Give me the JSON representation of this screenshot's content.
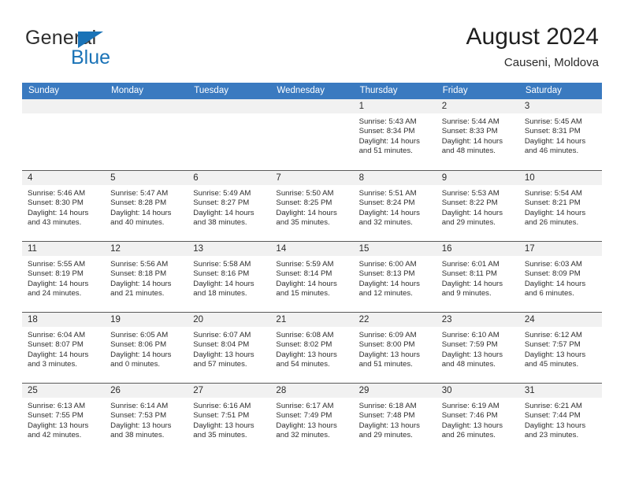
{
  "brand": {
    "name_top": "General",
    "name_bottom": "Blue",
    "accent_color": "#1a73b7",
    "triangle_icon": "triangle-icon"
  },
  "header": {
    "title": "August 2024",
    "subtitle": "Causeni, Moldova",
    "header_bg": "#3a7ac0",
    "header_text": "#ffffff"
  },
  "calendar": {
    "weekday_headers": [
      "Sunday",
      "Monday",
      "Tuesday",
      "Wednesday",
      "Thursday",
      "Friday",
      "Saturday"
    ],
    "labels": {
      "sunrise": "Sunrise:",
      "sunset": "Sunset:",
      "daylight": "Daylight:"
    },
    "weeks": [
      [
        {
          "day": ""
        },
        {
          "day": ""
        },
        {
          "day": ""
        },
        {
          "day": ""
        },
        {
          "day": "1",
          "sunrise": "Sunrise: 5:43 AM",
          "sunset": "Sunset: 8:34 PM",
          "daylight1": "Daylight: 14 hours",
          "daylight2": "and 51 minutes."
        },
        {
          "day": "2",
          "sunrise": "Sunrise: 5:44 AM",
          "sunset": "Sunset: 8:33 PM",
          "daylight1": "Daylight: 14 hours",
          "daylight2": "and 48 minutes."
        },
        {
          "day": "3",
          "sunrise": "Sunrise: 5:45 AM",
          "sunset": "Sunset: 8:31 PM",
          "daylight1": "Daylight: 14 hours",
          "daylight2": "and 46 minutes."
        }
      ],
      [
        {
          "day": "4",
          "sunrise": "Sunrise: 5:46 AM",
          "sunset": "Sunset: 8:30 PM",
          "daylight1": "Daylight: 14 hours",
          "daylight2": "and 43 minutes."
        },
        {
          "day": "5",
          "sunrise": "Sunrise: 5:47 AM",
          "sunset": "Sunset: 8:28 PM",
          "daylight1": "Daylight: 14 hours",
          "daylight2": "and 40 minutes."
        },
        {
          "day": "6",
          "sunrise": "Sunrise: 5:49 AM",
          "sunset": "Sunset: 8:27 PM",
          "daylight1": "Daylight: 14 hours",
          "daylight2": "and 38 minutes."
        },
        {
          "day": "7",
          "sunrise": "Sunrise: 5:50 AM",
          "sunset": "Sunset: 8:25 PM",
          "daylight1": "Daylight: 14 hours",
          "daylight2": "and 35 minutes."
        },
        {
          "day": "8",
          "sunrise": "Sunrise: 5:51 AM",
          "sunset": "Sunset: 8:24 PM",
          "daylight1": "Daylight: 14 hours",
          "daylight2": "and 32 minutes."
        },
        {
          "day": "9",
          "sunrise": "Sunrise: 5:53 AM",
          "sunset": "Sunset: 8:22 PM",
          "daylight1": "Daylight: 14 hours",
          "daylight2": "and 29 minutes."
        },
        {
          "day": "10",
          "sunrise": "Sunrise: 5:54 AM",
          "sunset": "Sunset: 8:21 PM",
          "daylight1": "Daylight: 14 hours",
          "daylight2": "and 26 minutes."
        }
      ],
      [
        {
          "day": "11",
          "sunrise": "Sunrise: 5:55 AM",
          "sunset": "Sunset: 8:19 PM",
          "daylight1": "Daylight: 14 hours",
          "daylight2": "and 24 minutes."
        },
        {
          "day": "12",
          "sunrise": "Sunrise: 5:56 AM",
          "sunset": "Sunset: 8:18 PM",
          "daylight1": "Daylight: 14 hours",
          "daylight2": "and 21 minutes."
        },
        {
          "day": "13",
          "sunrise": "Sunrise: 5:58 AM",
          "sunset": "Sunset: 8:16 PM",
          "daylight1": "Daylight: 14 hours",
          "daylight2": "and 18 minutes."
        },
        {
          "day": "14",
          "sunrise": "Sunrise: 5:59 AM",
          "sunset": "Sunset: 8:14 PM",
          "daylight1": "Daylight: 14 hours",
          "daylight2": "and 15 minutes."
        },
        {
          "day": "15",
          "sunrise": "Sunrise: 6:00 AM",
          "sunset": "Sunset: 8:13 PM",
          "daylight1": "Daylight: 14 hours",
          "daylight2": "and 12 minutes."
        },
        {
          "day": "16",
          "sunrise": "Sunrise: 6:01 AM",
          "sunset": "Sunset: 8:11 PM",
          "daylight1": "Daylight: 14 hours",
          "daylight2": "and 9 minutes."
        },
        {
          "day": "17",
          "sunrise": "Sunrise: 6:03 AM",
          "sunset": "Sunset: 8:09 PM",
          "daylight1": "Daylight: 14 hours",
          "daylight2": "and 6 minutes."
        }
      ],
      [
        {
          "day": "18",
          "sunrise": "Sunrise: 6:04 AM",
          "sunset": "Sunset: 8:07 PM",
          "daylight1": "Daylight: 14 hours",
          "daylight2": "and 3 minutes."
        },
        {
          "day": "19",
          "sunrise": "Sunrise: 6:05 AM",
          "sunset": "Sunset: 8:06 PM",
          "daylight1": "Daylight: 14 hours",
          "daylight2": "and 0 minutes."
        },
        {
          "day": "20",
          "sunrise": "Sunrise: 6:07 AM",
          "sunset": "Sunset: 8:04 PM",
          "daylight1": "Daylight: 13 hours",
          "daylight2": "and 57 minutes."
        },
        {
          "day": "21",
          "sunrise": "Sunrise: 6:08 AM",
          "sunset": "Sunset: 8:02 PM",
          "daylight1": "Daylight: 13 hours",
          "daylight2": "and 54 minutes."
        },
        {
          "day": "22",
          "sunrise": "Sunrise: 6:09 AM",
          "sunset": "Sunset: 8:00 PM",
          "daylight1": "Daylight: 13 hours",
          "daylight2": "and 51 minutes."
        },
        {
          "day": "23",
          "sunrise": "Sunrise: 6:10 AM",
          "sunset": "Sunset: 7:59 PM",
          "daylight1": "Daylight: 13 hours",
          "daylight2": "and 48 minutes."
        },
        {
          "day": "24",
          "sunrise": "Sunrise: 6:12 AM",
          "sunset": "Sunset: 7:57 PM",
          "daylight1": "Daylight: 13 hours",
          "daylight2": "and 45 minutes."
        }
      ],
      [
        {
          "day": "25",
          "sunrise": "Sunrise: 6:13 AM",
          "sunset": "Sunset: 7:55 PM",
          "daylight1": "Daylight: 13 hours",
          "daylight2": "and 42 minutes."
        },
        {
          "day": "26",
          "sunrise": "Sunrise: 6:14 AM",
          "sunset": "Sunset: 7:53 PM",
          "daylight1": "Daylight: 13 hours",
          "daylight2": "and 38 minutes."
        },
        {
          "day": "27",
          "sunrise": "Sunrise: 6:16 AM",
          "sunset": "Sunset: 7:51 PM",
          "daylight1": "Daylight: 13 hours",
          "daylight2": "and 35 minutes."
        },
        {
          "day": "28",
          "sunrise": "Sunrise: 6:17 AM",
          "sunset": "Sunset: 7:49 PM",
          "daylight1": "Daylight: 13 hours",
          "daylight2": "and 32 minutes."
        },
        {
          "day": "29",
          "sunrise": "Sunrise: 6:18 AM",
          "sunset": "Sunset: 7:48 PM",
          "daylight1": "Daylight: 13 hours",
          "daylight2": "and 29 minutes."
        },
        {
          "day": "30",
          "sunrise": "Sunrise: 6:19 AM",
          "sunset": "Sunset: 7:46 PM",
          "daylight1": "Daylight: 13 hours",
          "daylight2": "and 26 minutes."
        },
        {
          "day": "31",
          "sunrise": "Sunrise: 6:21 AM",
          "sunset": "Sunset: 7:44 PM",
          "daylight1": "Daylight: 13 hours",
          "daylight2": "and 23 minutes."
        }
      ]
    ]
  }
}
